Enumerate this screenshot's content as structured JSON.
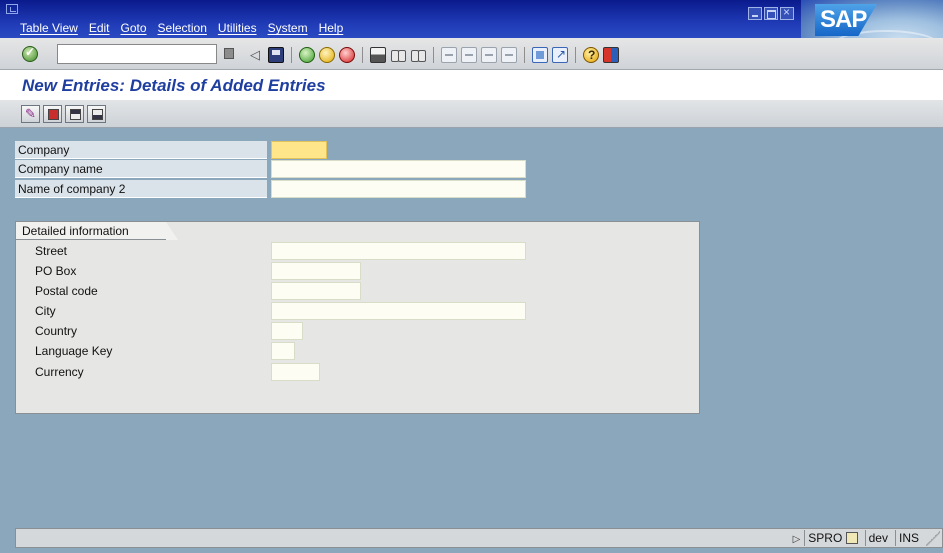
{
  "menu": {
    "items": [
      "Table View",
      "Edit",
      "Goto",
      "Selection",
      "Utilities",
      "System",
      "Help"
    ]
  },
  "logo": {
    "text": "SAP"
  },
  "command_field": {
    "value": ""
  },
  "screen": {
    "title": "New Entries: Details of Added Entries"
  },
  "fields": {
    "company": {
      "label": "Company",
      "value": ""
    },
    "company_name": {
      "label": "Company name",
      "value": ""
    },
    "company_name2": {
      "label": "Name of company 2",
      "value": ""
    }
  },
  "detail_group": {
    "title": "Detailed information",
    "fields": [
      {
        "label": "Street",
        "value": ""
      },
      {
        "label": "PO Box",
        "value": ""
      },
      {
        "label": "Postal code",
        "value": ""
      },
      {
        "label": "City",
        "value": ""
      },
      {
        "label": "Country",
        "value": ""
      },
      {
        "label": "Language Key",
        "value": ""
      },
      {
        "label": "Currency",
        "value": ""
      }
    ]
  },
  "status": {
    "transaction": "SPRO",
    "system": "dev",
    "mode": "INS"
  },
  "icons": {
    "standard_toolbar": [
      "enter-icon",
      "command-dropdown-icon",
      "back-arrow-icon",
      "save-icon",
      "back-icon",
      "exit-icon",
      "cancel-icon",
      "print-icon",
      "find-icon",
      "find-next-icon",
      "first-page-icon",
      "previous-page-icon",
      "next-page-icon",
      "last-page-icon",
      "new-session-icon",
      "shortcut-icon",
      "help-icon",
      "layout-icon"
    ],
    "application_toolbar": [
      "change-icon",
      "details-icon",
      "previous-entry-icon",
      "next-entry-icon"
    ]
  },
  "colors": {
    "title": "#1f3fa0",
    "required_field": "#ffe68a",
    "background": "#8ba7bc"
  }
}
